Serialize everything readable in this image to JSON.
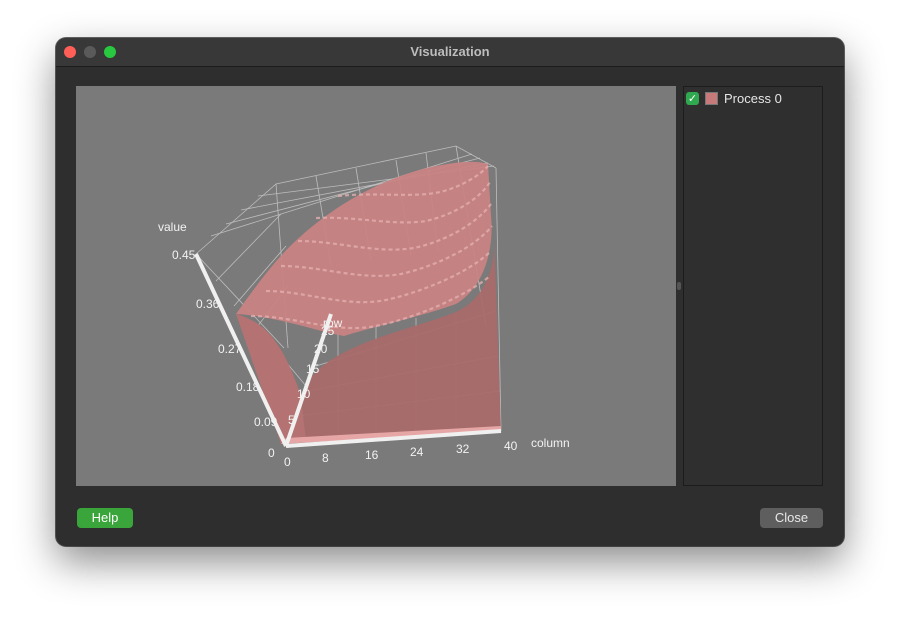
{
  "window": {
    "title": "Visualization"
  },
  "legend": {
    "items": [
      {
        "label": "Process 0",
        "checked": true,
        "color": "#c87a7a"
      }
    ]
  },
  "buttons": {
    "help_label": "Help",
    "close_label": "Close"
  },
  "chart_data": {
    "type": "surface3d",
    "series": [
      {
        "name": "Process 0"
      }
    ],
    "axes": {
      "value": {
        "label": "value",
        "ticks": [
          "0",
          "0.09",
          "0.18",
          "0.27",
          "0.36",
          "0.45"
        ]
      },
      "row": {
        "label": "row",
        "ticks": [
          "0",
          "5",
          "10",
          "15",
          "20",
          "25"
        ]
      },
      "column": {
        "label": "column",
        "ticks": [
          "0",
          "8",
          "16",
          "24",
          "32",
          "40"
        ]
      }
    },
    "colors": {
      "surface": "#c87a7a",
      "background": "#7a7a7a"
    },
    "grid": true
  }
}
